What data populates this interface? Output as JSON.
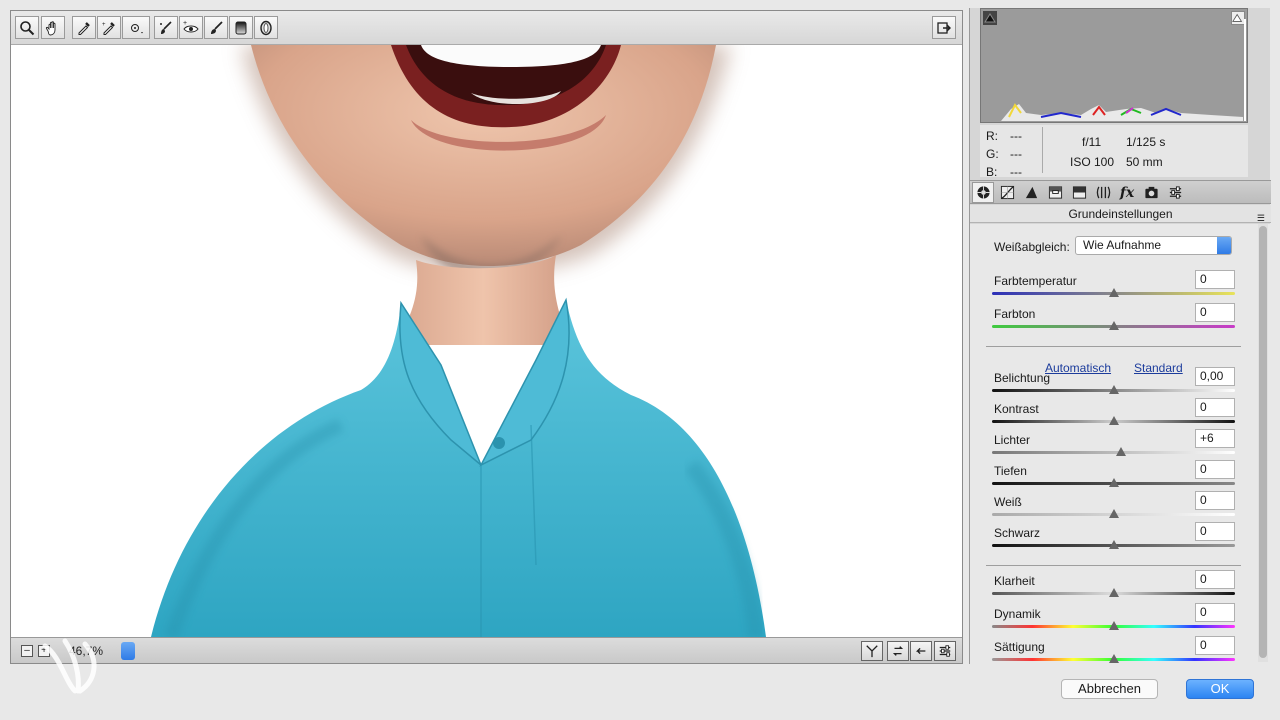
{
  "toolbar": {
    "tools": [
      "zoom-icon",
      "hand-icon",
      "white-balance-eyedropper-icon",
      "color-sampler-icon",
      "target-adjust-icon",
      "crop-icon",
      "red-eye-icon",
      "adjustment-brush-icon",
      "graduated-filter-icon",
      "radial-filter-icon"
    ]
  },
  "bottombar": {
    "zoom": "46,7%"
  },
  "info": {
    "r_label": "R:",
    "r_value": "---",
    "g_label": "G:",
    "g_value": "---",
    "b_label": "B:",
    "b_value": "---",
    "aperture": "f/11",
    "shutter": "1/125 s",
    "iso": "ISO 100",
    "focal": "50 mm"
  },
  "panel": {
    "section_title": "Grundeinstellungen",
    "wb_label": "Weißabgleich:",
    "wb_value": "Wie Aufnahme",
    "auto_link": "Automatisch",
    "standard_link": "Standard",
    "controls": [
      {
        "label": "Farbtemperatur",
        "value": "0",
        "pos": 0.5
      },
      {
        "label": "Farbton",
        "value": "0",
        "pos": 0.5
      },
      {
        "label": "Belichtung",
        "value": "0,00",
        "pos": 0.5
      },
      {
        "label": "Kontrast",
        "value": "0",
        "pos": 0.5
      },
      {
        "label": "Lichter",
        "value": "+6",
        "pos": 0.53
      },
      {
        "label": "Tiefen",
        "value": "0",
        "pos": 0.5
      },
      {
        "label": "Weiß",
        "value": "0",
        "pos": 0.5
      },
      {
        "label": "Schwarz",
        "value": "0",
        "pos": 0.5
      },
      {
        "label": "Klarheit",
        "value": "0",
        "pos": 0.5
      },
      {
        "label": "Dynamik",
        "value": "0",
        "pos": 0.5
      },
      {
        "label": "Sättigung",
        "value": "0",
        "pos": 0.5
      }
    ]
  },
  "footer": {
    "cancel": "Abbrechen",
    "ok": "OK"
  },
  "colors": {
    "accent": "#2f7be6",
    "shirt": "#37aec9",
    "skin": "#e6b49b"
  }
}
